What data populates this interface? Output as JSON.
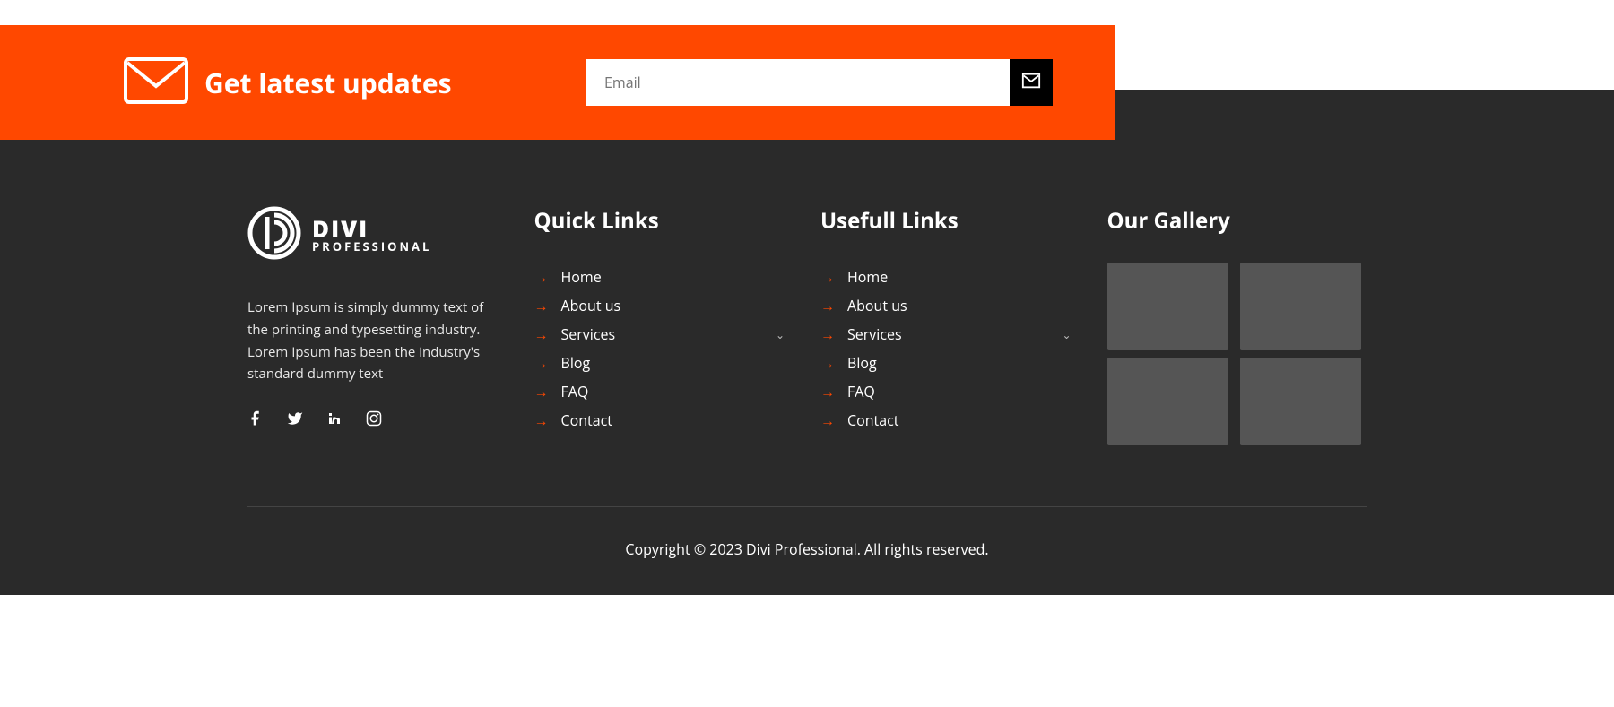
{
  "subscribe": {
    "title": "Get latest updates",
    "placeholder": "Email"
  },
  "logo": {
    "line1": "DIVI",
    "line2": "PROFESSIONAL"
  },
  "about": {
    "text": "Lorem Ipsum is simply dummy text of the printing and typesetting industry. Lorem Ipsum has been the industry's standard dummy text"
  },
  "columns": {
    "quick": {
      "heading": "Quick Links",
      "items": [
        "Home",
        "About us",
        "Services",
        "Blog",
        "FAQ",
        "Contact"
      ],
      "has_submenu_index": 2
    },
    "useful": {
      "heading": "Usefull Links",
      "items": [
        "Home",
        "About us",
        "Services",
        "Blog",
        "FAQ",
        "Contact"
      ],
      "has_submenu_index": 2
    },
    "gallery": {
      "heading": "Our Gallery"
    }
  },
  "copyright": "Copyright © 2023 Divi Professional. All rights reserved."
}
